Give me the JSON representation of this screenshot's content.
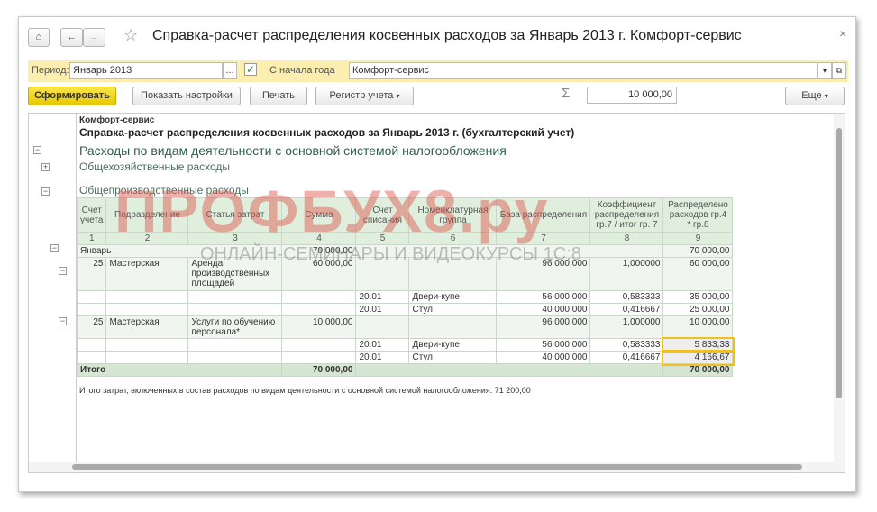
{
  "window": {
    "title": "Справка-расчет распределения косвенных расходов за Январь 2013 г. Комфорт-сервис"
  },
  "nav": {
    "home": "⌂",
    "back": "←",
    "forward": "→",
    "star": "☆",
    "close": "×"
  },
  "filter": {
    "period_label": "Период:",
    "period_value": "Январь 2013",
    "period_btn": "...",
    "checked": true,
    "from_year_label": "С начала года",
    "org_value": "Комфорт-сервис"
  },
  "toolbar": {
    "generate": "Сформировать",
    "show_settings": "Показать настройки",
    "print": "Печать",
    "register": "Регистр учета",
    "sum_icon": "Σ",
    "sum_value": "10 000,00",
    "more": "Еще"
  },
  "report": {
    "org": "Комфорт-сервис",
    "heading": "Справка-расчет распределения косвенных расходов  за Январь 2013 г. (бухгалтерский учет)",
    "section": "Расходы по видам деятельности с основной системой налогообложения",
    "group1": "Общехозяйственные расходы",
    "group2": "Общепроизводственные расходы",
    "columns": [
      "Счет учета",
      "Подразделение",
      "Статья затрат",
      "Сумма",
      "Счет списания",
      "Номенклатурная группа",
      "База распределения",
      "Коэффициент распределения гр.7 / итог гр. 7",
      "Распределено расходов гр.4 * гр.8"
    ],
    "col_numbers": [
      "1",
      "2",
      "3",
      "4",
      "5",
      "6",
      "7",
      "8",
      "9"
    ],
    "month": {
      "label": "Январь",
      "sum": "70 000,00",
      "distributed": "70 000,00"
    },
    "rows": [
      {
        "account": "25",
        "dept": "Мастерская",
        "item": "Аренда производственных площадей",
        "sum": "60 000,00",
        "base": "96 000,000",
        "coef": "1,000000",
        "dist": "60 000,00",
        "subs": [
          {
            "acc": "20.01",
            "group": "Двери-купе",
            "base": "56 000,000",
            "coef": "0,583333",
            "dist": "35 000,00"
          },
          {
            "acc": "20.01",
            "group": "Стул",
            "base": "40 000,000",
            "coef": "0,416667",
            "dist": "25 000,00"
          }
        ]
      },
      {
        "account": "25",
        "dept": "Мастерская",
        "item": "Услуги по обучению персонала*",
        "sum": "10 000,00",
        "base": "96 000,000",
        "coef": "1,000000",
        "dist": "10 000,00",
        "subs": [
          {
            "acc": "20.01",
            "group": "Двери-купе",
            "base": "56 000,000",
            "coef": "0,583333",
            "dist": "5 833,33"
          },
          {
            "acc": "20.01",
            "group": "Стул",
            "base": "40 000,000",
            "coef": "0,416667",
            "dist": "4 166,67"
          }
        ]
      }
    ],
    "total": {
      "label": "Итого",
      "sum": "70 000,00",
      "dist": "70 000,00"
    },
    "footer": "Итого затрат, включенных в состав расходов по видам деятельности с основной системой налогообложения:  71 200,00"
  },
  "watermark": {
    "logo": "ПРОФБУХ8.ру",
    "tagline": "ОНЛАЙН-СЕМИНАРЫ И ВИДЕОКУРСЫ 1С:8"
  },
  "colors": {
    "accent": "#f5d000",
    "filter_bg": "#fbeeae",
    "table_header": "#dfeedd",
    "selection": "#f0c020"
  }
}
